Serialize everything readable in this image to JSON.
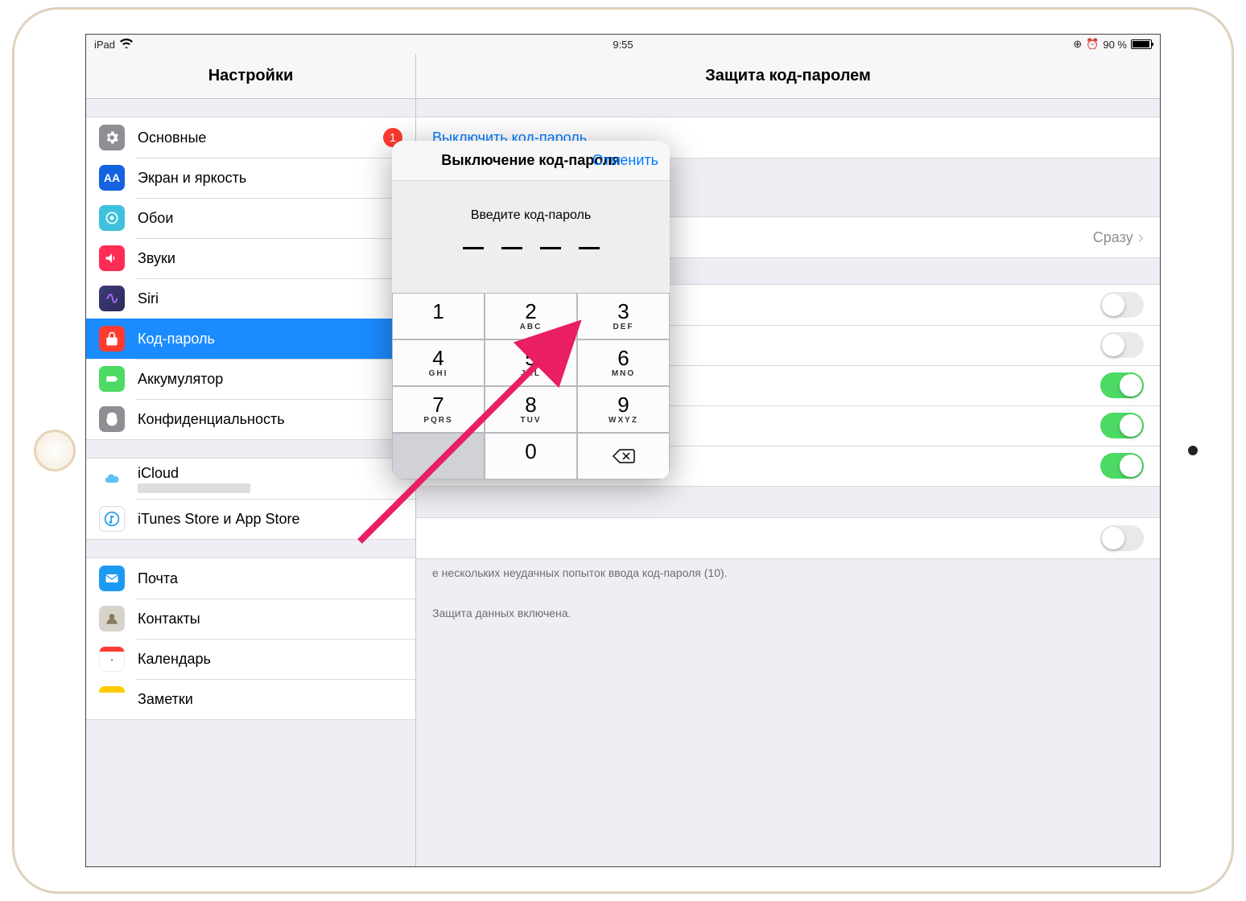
{
  "status": {
    "carrier": "iPad",
    "time": "9:55",
    "battery_text": "90 %"
  },
  "sidebar": {
    "title": "Настройки",
    "groups": [
      {
        "items": [
          {
            "label": "Основные",
            "icon": "general-icon",
            "badge": "1"
          },
          {
            "label": "Экран и яркость",
            "icon": "display-icon"
          },
          {
            "label": "Обои",
            "icon": "wallpaper-icon"
          },
          {
            "label": "Звуки",
            "icon": "sounds-icon"
          },
          {
            "label": "Siri",
            "icon": "siri-icon"
          },
          {
            "label": "Код-пароль",
            "icon": "passcode-icon",
            "selected": true
          },
          {
            "label": "Аккумулятор",
            "icon": "battery-icon"
          },
          {
            "label": "Конфиденциальность",
            "icon": "privacy-icon"
          }
        ]
      },
      {
        "items": [
          {
            "label": "iCloud",
            "icon": "icloud-icon",
            "subredacted": true
          },
          {
            "label": "iTunes Store и App Store",
            "icon": "itunes-icon"
          }
        ]
      },
      {
        "items": [
          {
            "label": "Почта",
            "icon": "mail-icon"
          },
          {
            "label": "Контакты",
            "icon": "contacts-icon"
          },
          {
            "label": "Календарь",
            "icon": "calendar-icon"
          },
          {
            "label": "Заметки",
            "icon": "notes-icon"
          }
        ]
      }
    ]
  },
  "detail": {
    "title": "Защита код-паролем",
    "turn_off_label": "Выключить код-пароль",
    "require_value": "Сразу",
    "switches": [
      false,
      false,
      true,
      true,
      true,
      false
    ],
    "footer1": "е нескольких неудачных попыток ввода код-пароля (10).",
    "footer2": "Защита данных включена."
  },
  "popover": {
    "title": "Выключение код-пароля",
    "cancel": "Отменить",
    "instruction": "Введите код-пароль",
    "keys": [
      {
        "n": "1",
        "l": ""
      },
      {
        "n": "2",
        "l": "ABC"
      },
      {
        "n": "3",
        "l": "DEF"
      },
      {
        "n": "4",
        "l": "GHI"
      },
      {
        "n": "5",
        "l": "JKL"
      },
      {
        "n": "6",
        "l": "MNO"
      },
      {
        "n": "7",
        "l": "PQRS"
      },
      {
        "n": "8",
        "l": "TUV"
      },
      {
        "n": "9",
        "l": "WXYZ"
      },
      {
        "n": "",
        "l": "",
        "blank": true
      },
      {
        "n": "0",
        "l": ""
      },
      {
        "n": "⌫",
        "l": "",
        "back": true
      }
    ]
  }
}
